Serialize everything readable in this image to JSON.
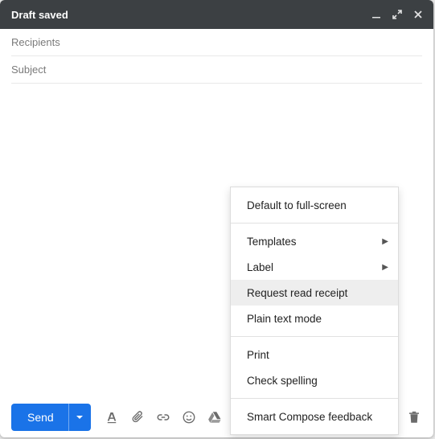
{
  "titlebar": {
    "title": "Draft saved"
  },
  "fields": {
    "recipients_placeholder": "Recipients",
    "subject_placeholder": "Subject"
  },
  "toolbar": {
    "send_label": "Send"
  },
  "menu": {
    "default_fullscreen": "Default to full-screen",
    "templates": "Templates",
    "label": "Label",
    "request_read_receipt": "Request read receipt",
    "plain_text_mode": "Plain text mode",
    "print": "Print",
    "check_spelling": "Check spelling",
    "smart_compose_feedback": "Smart Compose feedback"
  }
}
